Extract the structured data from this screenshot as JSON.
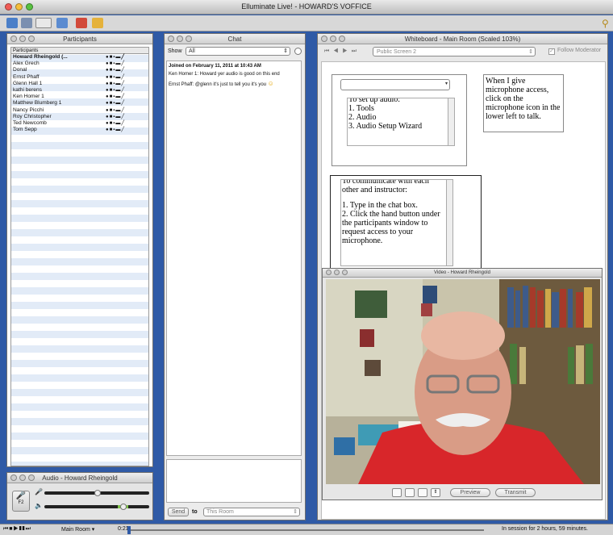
{
  "app": {
    "window_title": "Elluminate Live! - HOWARD'S VOFFICE"
  },
  "participants": {
    "title": "Participants",
    "column_header": "Participants",
    "names": [
      "Howard Rheingold (...",
      "Alex Grech",
      "Donal",
      "Ernst Phaff",
      "Glenn Hall 1",
      "kathi berens",
      "Ken Homer 1",
      "Matthew Blumberg 1",
      "Nancy Picchi",
      "Roy Christopher",
      "Ted Newcomb",
      "Tom Sepp"
    ]
  },
  "audio": {
    "title": "Audio - Howard Rheingold",
    "talk_label": "F2"
  },
  "chat": {
    "title": "Chat",
    "show_label": "Show",
    "show_value": "All",
    "messages": [
      "Joined on February 11, 2011 at 10:43 AM",
      "Ken Homer 1: Howard yer audio is good on this end",
      "Ernst Phaff: @glenn it's just to tell you it's you"
    ],
    "send_label": "Send",
    "to_label": "to",
    "to_value": "This Room"
  },
  "whiteboard": {
    "title": "Whiteboard - Main Room (Scaled 103%)",
    "screen_value": "Public Screen 2",
    "follow_label": "Follow Moderator",
    "audio_box_lines": [
      "To set up audio:",
      "1.  Tools",
      "2.  Audio",
      "3.  Audio Setup Wizard"
    ],
    "mic_note": "When I give microphone access, click on the microphone icon in the lower left to talk.",
    "comm_box_lines": [
      "To communicate with each other and instructor:",
      "",
      "1.  Type in the chat box.",
      "2.  Click the hand button under the participants window to request access to your microphone."
    ]
  },
  "video": {
    "title": "Video - Howard Rheingold",
    "preview_label": "Preview",
    "transmit_label": "Transmit"
  },
  "status": {
    "room": "Main Room",
    "time": "0:21",
    "session": "In session for 2 hours, 59 minutes."
  },
  "colors": {
    "desktop": "#2f5aa6",
    "accent_red": "#d8262a"
  }
}
